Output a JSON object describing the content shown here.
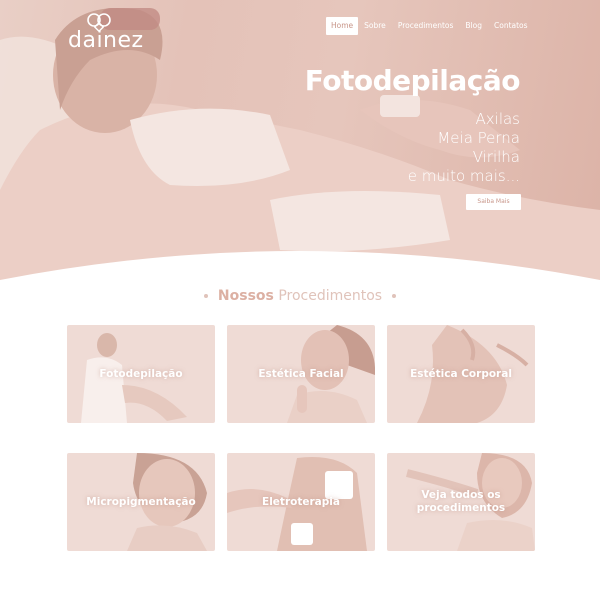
{
  "header": {
    "logo_text": "dainez",
    "nav": [
      {
        "label": "Home",
        "active": true
      },
      {
        "label": "Sobre"
      },
      {
        "label": "Procedimentos"
      },
      {
        "label": "Blog"
      },
      {
        "label": "Contatos"
      }
    ]
  },
  "hero": {
    "title": "Fotodepilação",
    "items": [
      "Axilas",
      "Meia Perna",
      "Virilha",
      "e muito mais..."
    ],
    "button_label": "Saiba Mais"
  },
  "section": {
    "title_bold": "Nossos",
    "title_light": "Procedimentos"
  },
  "procedures": [
    {
      "label": "Fotodepilação"
    },
    {
      "label": "Estética Facial"
    },
    {
      "label": "Estética Corporal"
    },
    {
      "label": "Micropigmentação"
    },
    {
      "label": "Eletroterapia"
    },
    {
      "label": "Veja todos os procedimentos"
    }
  ],
  "colors": {
    "accent": "#dcb0a3",
    "hero_bg": "#e4c2b8",
    "card_bg": "#eed8d2"
  }
}
